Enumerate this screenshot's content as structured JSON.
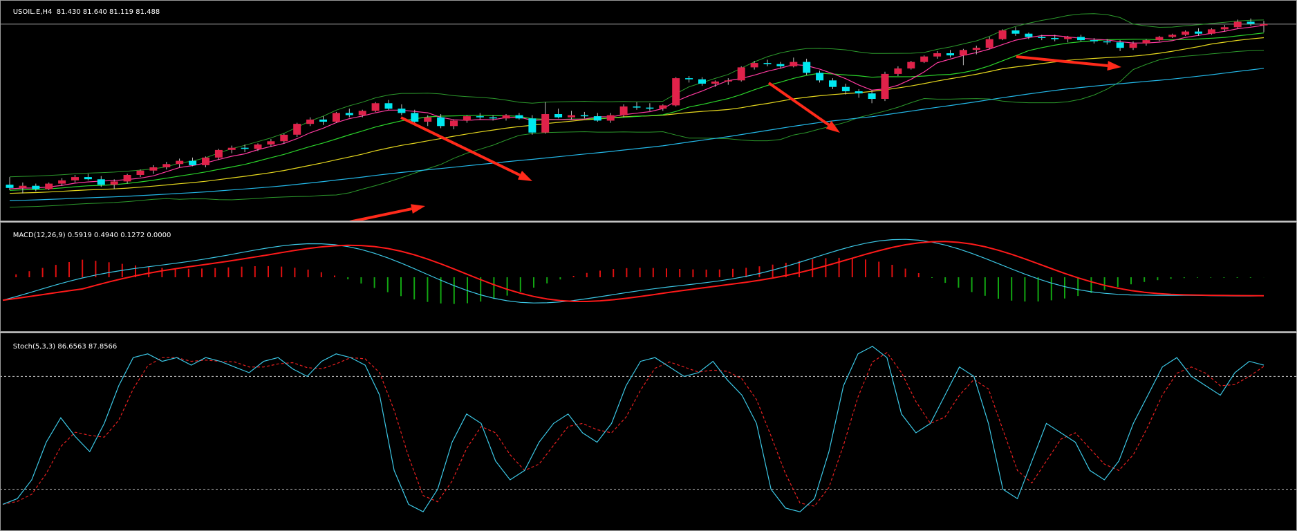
{
  "main_header": {
    "symbol_tf": "USOIL.E,H4",
    "ohlc": "81.430 81.640 81.119 81.488"
  },
  "macd_header": {
    "name": "MACD(12,26,9)",
    "values": "0.5919 0.4940 0.1272 0.0000"
  },
  "stoch_header": {
    "name": "Stoch(5,3,3)",
    "values": "86.6563 87.8566"
  },
  "colors": {
    "background": "#000000",
    "bull_candle": "#e0224a",
    "bear_candle": "#00e8f0",
    "wick": "#c0c0c0",
    "ma_fast": "#ff3aa0",
    "ma_mid": "#2bd42b",
    "ma_slow": "#e6d81e",
    "ma_long": "#23b8e8",
    "bollinger": "#2c9a2c",
    "arrow": "#ff2a1a",
    "macd_main": "#3cc8e6",
    "macd_signal": "#ff1a1a",
    "hist_up": "#e01010",
    "hist_down": "#12a612",
    "stoch_main": "#3cc8e6",
    "stoch_signal": "#e82020",
    "level_line": "#c8c8c8"
  },
  "chart_data": [
    {
      "type": "candlestick",
      "symbol": "USOIL.E",
      "timeframe": "H4",
      "last_bar": {
        "open": 81.43,
        "high": 81.64,
        "low": 81.119,
        "close": 81.488
      },
      "price_range_approx": [
        72.8,
        81.9
      ],
      "candles_ohlc": [
        [
          74.1,
          74.45,
          73.85,
          73.95
        ],
        [
          73.95,
          74.2,
          73.7,
          74.05
        ],
        [
          74.05,
          74.15,
          73.8,
          73.9
        ],
        [
          73.9,
          74.2,
          73.85,
          74.15
        ],
        [
          74.15,
          74.4,
          74.05,
          74.3
        ],
        [
          74.3,
          74.55,
          74.2,
          74.45
        ],
        [
          74.45,
          74.6,
          74.3,
          74.35
        ],
        [
          74.35,
          74.5,
          74.0,
          74.1
        ],
        [
          74.1,
          74.35,
          73.9,
          74.25
        ],
        [
          74.25,
          74.6,
          74.15,
          74.55
        ],
        [
          74.55,
          74.8,
          74.45,
          74.75
        ],
        [
          74.75,
          75.0,
          74.6,
          74.9
        ],
        [
          74.9,
          75.15,
          74.8,
          75.05
        ],
        [
          75.05,
          75.3,
          74.9,
          75.2
        ],
        [
          75.2,
          75.35,
          74.95,
          75.0
        ],
        [
          75.0,
          75.4,
          74.9,
          75.35
        ],
        [
          75.35,
          75.75,
          75.25,
          75.7
        ],
        [
          75.7,
          75.9,
          75.55,
          75.8
        ],
        [
          75.8,
          75.95,
          75.6,
          75.75
        ],
        [
          75.75,
          76.0,
          75.65,
          75.95
        ],
        [
          75.95,
          76.2,
          75.85,
          76.1
        ],
        [
          76.1,
          76.45,
          76.0,
          76.4
        ],
        [
          76.4,
          76.95,
          76.3,
          76.9
        ],
        [
          76.9,
          77.2,
          76.8,
          77.1
        ],
        [
          77.1,
          77.25,
          76.85,
          77.0
        ],
        [
          77.0,
          77.45,
          76.95,
          77.4
        ],
        [
          77.4,
          77.6,
          77.2,
          77.3
        ],
        [
          77.3,
          77.55,
          77.2,
          77.5
        ],
        [
          77.5,
          77.9,
          77.45,
          77.85
        ],
        [
          77.85,
          78.0,
          77.55,
          77.6
        ],
        [
          77.6,
          77.8,
          77.3,
          77.4
        ],
        [
          77.4,
          77.55,
          76.9,
          77.0
        ],
        [
          77.0,
          77.3,
          76.8,
          77.2
        ],
        [
          77.2,
          77.35,
          76.7,
          76.8
        ],
        [
          76.8,
          77.1,
          76.65,
          77.05
        ],
        [
          77.05,
          77.3,
          76.95,
          77.25
        ],
        [
          77.25,
          77.4,
          77.1,
          77.2
        ],
        [
          77.2,
          77.3,
          77.05,
          77.15
        ],
        [
          77.15,
          77.35,
          77.05,
          77.3
        ],
        [
          77.3,
          77.4,
          77.1,
          77.15
        ],
        [
          77.15,
          77.3,
          76.4,
          76.5
        ],
        [
          76.5,
          77.9,
          76.45,
          77.35
        ],
        [
          77.35,
          77.6,
          77.15,
          77.2
        ],
        [
          77.2,
          77.5,
          77.1,
          77.3
        ],
        [
          77.3,
          77.45,
          77.15,
          77.25
        ],
        [
          77.25,
          77.4,
          77.0,
          77.05
        ],
        [
          77.05,
          77.4,
          76.95,
          77.3
        ],
        [
          77.3,
          77.8,
          77.2,
          77.7
        ],
        [
          77.7,
          77.9,
          77.55,
          77.65
        ],
        [
          77.65,
          77.85,
          77.5,
          77.6
        ],
        [
          77.6,
          77.8,
          77.5,
          77.75
        ],
        [
          77.75,
          79.05,
          77.7,
          79.0
        ],
        [
          79.0,
          79.1,
          78.8,
          78.95
        ],
        [
          78.95,
          79.05,
          78.65,
          78.75
        ],
        [
          78.75,
          78.9,
          78.6,
          78.85
        ],
        [
          78.85,
          79.0,
          78.7,
          78.9
        ],
        [
          78.9,
          79.55,
          78.85,
          79.5
        ],
        [
          79.5,
          79.8,
          79.4,
          79.7
        ],
        [
          79.7,
          79.85,
          79.55,
          79.65
        ],
        [
          79.65,
          79.75,
          79.45,
          79.55
        ],
        [
          79.55,
          79.95,
          79.5,
          79.75
        ],
        [
          79.75,
          79.9,
          79.15,
          79.25
        ],
        [
          79.25,
          79.35,
          78.8,
          78.9
        ],
        [
          78.9,
          79.0,
          78.5,
          78.6
        ],
        [
          78.6,
          78.75,
          78.25,
          78.4
        ],
        [
          78.4,
          78.5,
          78.1,
          78.3
        ],
        [
          78.3,
          78.45,
          77.85,
          78.05
        ],
        [
          78.05,
          79.3,
          77.95,
          79.2
        ],
        [
          79.2,
          79.55,
          79.1,
          79.45
        ],
        [
          79.45,
          79.8,
          79.4,
          79.75
        ],
        [
          79.75,
          80.05,
          79.7,
          80.0
        ],
        [
          80.0,
          80.25,
          79.9,
          80.15
        ],
        [
          80.15,
          80.3,
          79.95,
          80.05
        ],
        [
          80.05,
          80.35,
          79.6,
          80.3
        ],
        [
          80.3,
          80.5,
          80.1,
          80.4
        ],
        [
          80.4,
          80.9,
          80.35,
          80.8
        ],
        [
          80.8,
          81.25,
          80.75,
          81.2
        ],
        [
          81.2,
          81.35,
          80.95,
          81.05
        ],
        [
          81.05,
          81.1,
          80.8,
          80.9
        ],
        [
          80.9,
          81.0,
          80.75,
          80.85
        ],
        [
          80.85,
          81.0,
          80.7,
          80.8
        ],
        [
          80.8,
          80.95,
          80.65,
          80.9
        ],
        [
          80.9,
          81.0,
          80.7,
          80.75
        ],
        [
          80.75,
          80.85,
          80.6,
          80.7
        ],
        [
          80.7,
          80.8,
          80.55,
          80.65
        ],
        [
          80.65,
          80.75,
          80.25,
          80.4
        ],
        [
          80.4,
          80.7,
          80.3,
          80.6
        ],
        [
          80.6,
          80.8,
          80.5,
          80.75
        ],
        [
          80.75,
          80.95,
          80.7,
          80.9
        ],
        [
          80.9,
          81.05,
          80.85,
          81.0
        ],
        [
          81.0,
          81.2,
          80.95,
          81.15
        ],
        [
          81.15,
          81.3,
          80.95,
          81.05
        ],
        [
          81.05,
          81.3,
          81.0,
          81.25
        ],
        [
          81.25,
          81.45,
          81.15,
          81.35
        ],
        [
          81.35,
          81.7,
          81.3,
          81.6
        ],
        [
          81.6,
          81.75,
          81.4,
          81.5
        ],
        [
          81.43,
          81.64,
          81.119,
          81.488
        ]
      ],
      "moving_averages": [
        "fast (magenta)",
        "mid (green)",
        "slow (yellow)",
        "long (cyan)"
      ],
      "bollinger_bands": true,
      "annotations": [
        "red arrow up-trend",
        "red arrow pullback 1",
        "red arrow pullback 2",
        "red arrow pullback 3"
      ]
    },
    {
      "type": "macd",
      "params": [
        12,
        26,
        9
      ],
      "values": [
        0.5919,
        0.494,
        0.1272,
        0.0
      ],
      "range_approx": [
        -0.75,
        0.75
      ]
    },
    {
      "type": "stochastic",
      "params": [
        5,
        3,
        3
      ],
      "values": [
        86.6563,
        87.8566
      ],
      "levels": [
        80,
        20
      ],
      "range": [
        0,
        100
      ]
    }
  ]
}
